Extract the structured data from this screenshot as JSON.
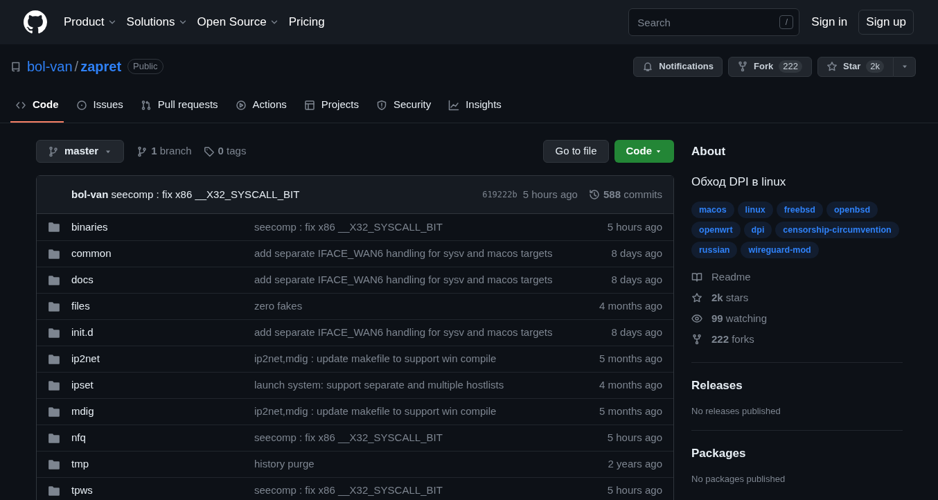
{
  "header": {
    "nav": [
      {
        "label": "Product",
        "dropdown": true
      },
      {
        "label": "Solutions",
        "dropdown": true
      },
      {
        "label": "Open Source",
        "dropdown": true
      },
      {
        "label": "Pricing",
        "dropdown": false
      }
    ],
    "search": {
      "placeholder": "Search",
      "shortcut": "/"
    },
    "sign_in": "Sign in",
    "sign_up": "Sign up"
  },
  "repo": {
    "owner": "bol-van",
    "separator": "/",
    "name": "zapret",
    "visibility": "Public",
    "notifications": "Notifications",
    "fork": {
      "label": "Fork",
      "count": "222"
    },
    "star": {
      "label": "Star",
      "count": "2k"
    }
  },
  "tabs": [
    {
      "label": "Code",
      "selected": true
    },
    {
      "label": "Issues",
      "selected": false
    },
    {
      "label": "Pull requests",
      "selected": false
    },
    {
      "label": "Actions",
      "selected": false
    },
    {
      "label": "Projects",
      "selected": false
    },
    {
      "label": "Security",
      "selected": false
    },
    {
      "label": "Insights",
      "selected": false
    }
  ],
  "toolbar": {
    "branch": "master",
    "branches": "**1** branch",
    "tags": "**0** tags",
    "go_to_file": "Go to file",
    "code": "Code"
  },
  "latest_commit": {
    "message": "**bol-van** seecomp : fix x86 __X32_SYSCALL_BIT",
    "hash": "619222b",
    "time": "5 hours ago",
    "commits": "**588** commits"
  },
  "files": [
    {
      "name": "binaries",
      "message": "seecomp : fix x86 __X32_SYSCALL_BIT",
      "time": "5 hours ago"
    },
    {
      "name": "common",
      "message": "add separate IFACE_WAN6 handling for sysv and macos targets",
      "time": "8 days ago"
    },
    {
      "name": "docs",
      "message": "add separate IFACE_WAN6 handling for sysv and macos targets",
      "time": "8 days ago"
    },
    {
      "name": "files",
      "message": "zero fakes",
      "time": "4 months ago"
    },
    {
      "name": "init.d",
      "message": "add separate IFACE_WAN6 handling for sysv and macos targets",
      "time": "8 days ago"
    },
    {
      "name": "ip2net",
      "message": "ip2net,mdig : update makefile to support win compile",
      "time": "5 months ago"
    },
    {
      "name": "ipset",
      "message": "launch system: support separate and multiple hostlists",
      "time": "4 months ago"
    },
    {
      "name": "mdig",
      "message": "ip2net,mdig : update makefile to support win compile",
      "time": "5 months ago"
    },
    {
      "name": "nfq",
      "message": "seecomp : fix x86 __X32_SYSCALL_BIT",
      "time": "5 hours ago"
    },
    {
      "name": "tmp",
      "message": "history purge",
      "time": "2 years ago"
    },
    {
      "name": "tpws",
      "message": "seecomp : fix x86 __X32_SYSCALL_BIT",
      "time": "5 hours ago"
    }
  ],
  "about": {
    "title": "About",
    "description": "Обход DPI в linux",
    "topics": [
      "macos",
      "linux",
      "freebsd",
      "openbsd",
      "openwrt",
      "dpi",
      "censorship-circumvention",
      "russian",
      "wireguard-mod"
    ],
    "stats": [
      {
        "kind": "readme",
        "text": "Readme"
      },
      {
        "kind": "stars",
        "text": "**2k** stars"
      },
      {
        "kind": "watching",
        "text": "**99** watching"
      },
      {
        "kind": "forks",
        "text": "**222** forks"
      }
    ]
  },
  "releases": {
    "title": "Releases",
    "text": "No releases published"
  },
  "packages": {
    "title": "Packages",
    "text": "No packages published"
  }
}
